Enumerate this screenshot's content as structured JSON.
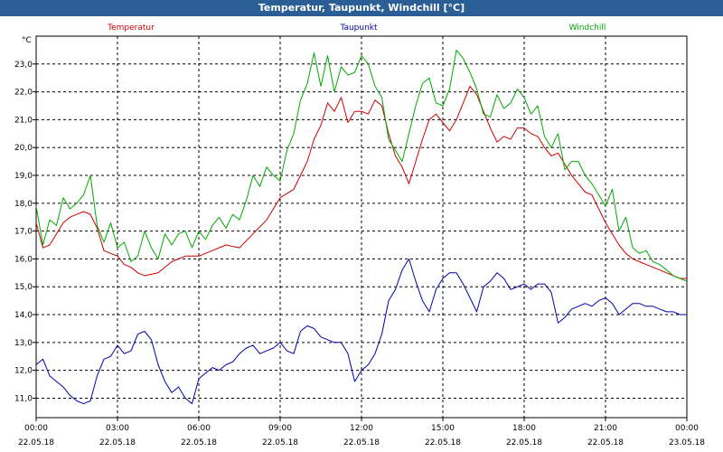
{
  "window": {
    "title": "Temperatur, Taupunkt, Windchill [°C]"
  },
  "chart_data": {
    "type": "line",
    "title": "Temperatur, Taupunkt, Windchill [°C]",
    "ylabel": "°C",
    "ylim": [
      10.3,
      24.0
    ],
    "xlim": [
      0,
      24
    ],
    "yticks": [
      11.0,
      12.0,
      13.0,
      14.0,
      15.0,
      16.0,
      17.0,
      18.0,
      19.0,
      20.0,
      21.0,
      22.0,
      23.0
    ],
    "ytick_labels": [
      "11,0",
      "12,0",
      "13,0",
      "14,0",
      "15,0",
      "16,0",
      "17,0",
      "18,0",
      "19,0",
      "20,0",
      "21,0",
      "22,0",
      "23,0"
    ],
    "xticks": [
      {
        "pos": 0,
        "time": "00:00",
        "date": "22.05.18"
      },
      {
        "pos": 3,
        "time": "03:00",
        "date": "22.05.18"
      },
      {
        "pos": 6,
        "time": "06:00",
        "date": "22.05.18"
      },
      {
        "pos": 9,
        "time": "09:00",
        "date": "22.05.18"
      },
      {
        "pos": 12,
        "time": "12:00",
        "date": "22.05.18"
      },
      {
        "pos": 15,
        "time": "15:00",
        "date": "22.05.18"
      },
      {
        "pos": 18,
        "time": "18:00",
        "date": "22.05.18"
      },
      {
        "pos": 21,
        "time": "21:00",
        "date": "22.05.18"
      },
      {
        "pos": 24,
        "time": "00:00",
        "date": "23.05.18"
      }
    ],
    "grid": true,
    "series": [
      {
        "name": "Temperatur",
        "color": "#cc0000",
        "x": [
          0,
          0.25,
          0.5,
          0.75,
          1,
          1.25,
          1.5,
          1.75,
          2,
          2.25,
          2.5,
          2.75,
          3,
          3.25,
          3.5,
          3.75,
          4,
          4.5,
          5,
          5.5,
          6,
          6.5,
          7,
          7.5,
          8,
          8.5,
          9,
          9.5,
          10,
          10.25,
          10.5,
          10.75,
          11,
          11.25,
          11.5,
          11.75,
          12,
          12.25,
          12.5,
          12.75,
          13,
          13.25,
          13.5,
          13.75,
          14,
          14.25,
          14.5,
          14.75,
          15,
          15.25,
          15.5,
          15.75,
          16,
          16.25,
          16.5,
          16.75,
          17,
          17.25,
          17.5,
          17.75,
          18,
          18.25,
          18.5,
          18.75,
          19,
          19.25,
          19.5,
          19.75,
          20,
          20.25,
          20.5,
          20.75,
          21,
          21.25,
          21.5,
          21.75,
          22,
          22.25,
          22.5,
          22.75,
          23,
          23.25,
          23.5,
          23.75,
          24
        ],
        "values": [
          17.3,
          16.4,
          16.5,
          16.9,
          17.3,
          17.5,
          17.6,
          17.7,
          17.6,
          17.1,
          16.3,
          16.2,
          16.1,
          15.8,
          15.7,
          15.5,
          15.4,
          15.5,
          15.9,
          16.1,
          16.1,
          16.3,
          16.5,
          16.4,
          16.9,
          17.4,
          18.2,
          18.5,
          19.5,
          20.3,
          20.8,
          21.6,
          21.3,
          21.8,
          20.9,
          21.3,
          21.3,
          21.2,
          21.7,
          21.5,
          20.5,
          19.7,
          19.3,
          18.7,
          19.5,
          20.3,
          21.0,
          21.2,
          20.9,
          20.6,
          21.0,
          21.6,
          22.2,
          21.9,
          21.3,
          20.7,
          20.2,
          20.4,
          20.3,
          20.7,
          20.7,
          20.5,
          20.4,
          20.0,
          19.7,
          19.8,
          19.4,
          19.0,
          18.7,
          18.4,
          18.3,
          17.8,
          17.3,
          16.9,
          16.5,
          16.2,
          16.0,
          15.9,
          15.8,
          15.7,
          15.6,
          15.5,
          15.4,
          15.3,
          15.3
        ]
      },
      {
        "name": "Taupunkt",
        "color": "#0000aa",
        "x": [
          0,
          0.25,
          0.5,
          0.75,
          1,
          1.25,
          1.5,
          1.75,
          2,
          2.25,
          2.5,
          2.75,
          3,
          3.25,
          3.5,
          3.75,
          4,
          4.25,
          4.5,
          4.75,
          5,
          5.25,
          5.5,
          5.75,
          6,
          6.25,
          6.5,
          6.75,
          7,
          7.25,
          7.5,
          7.75,
          8,
          8.25,
          8.5,
          8.75,
          9,
          9.25,
          9.5,
          9.75,
          10,
          10.25,
          10.5,
          10.75,
          11,
          11.25,
          11.5,
          11.75,
          12,
          12.25,
          12.5,
          12.75,
          13,
          13.25,
          13.5,
          13.75,
          14,
          14.25,
          14.5,
          14.75,
          15,
          15.25,
          15.5,
          15.75,
          16,
          16.25,
          16.5,
          16.75,
          17,
          17.25,
          17.5,
          17.75,
          18,
          18.25,
          18.5,
          18.75,
          19,
          19.25,
          19.5,
          19.75,
          20,
          20.25,
          20.5,
          20.75,
          21,
          21.25,
          21.5,
          21.75,
          22,
          22.25,
          22.5,
          22.75,
          23,
          23.25,
          23.5,
          23.75,
          24
        ],
        "values": [
          12.2,
          12.4,
          11.8,
          11.6,
          11.4,
          11.1,
          10.9,
          10.8,
          10.9,
          11.8,
          12.4,
          12.5,
          12.9,
          12.6,
          12.7,
          13.3,
          13.4,
          13.1,
          12.2,
          11.6,
          11.2,
          11.4,
          11.0,
          10.8,
          11.7,
          11.9,
          12.1,
          12.0,
          12.2,
          12.3,
          12.6,
          12.8,
          12.9,
          12.6,
          12.7,
          12.8,
          13.0,
          12.7,
          12.6,
          13.4,
          13.6,
          13.5,
          13.2,
          13.1,
          13.0,
          13.0,
          12.6,
          11.6,
          12.0,
          12.2,
          12.6,
          13.3,
          14.5,
          14.9,
          15.6,
          16.0,
          15.2,
          14.5,
          14.1,
          14.9,
          15.3,
          15.5,
          15.5,
          15.1,
          14.6,
          14.1,
          15.0,
          15.2,
          15.5,
          15.3,
          14.9,
          15.0,
          15.1,
          14.9,
          15.1,
          15.1,
          14.8,
          13.7,
          13.9,
          14.2,
          14.3,
          14.4,
          14.3,
          14.5,
          14.6,
          14.4,
          14.0,
          14.2,
          14.4,
          14.4,
          14.3,
          14.3,
          14.2,
          14.1,
          14.1,
          14.0,
          14.0
        ]
      },
      {
        "name": "Windchill",
        "color": "#00aa00",
        "x": [
          0,
          0.25,
          0.5,
          0.75,
          1,
          1.25,
          1.5,
          1.75,
          2,
          2.25,
          2.5,
          2.75,
          3,
          3.25,
          3.5,
          3.75,
          4,
          4.25,
          4.5,
          4.75,
          5,
          5.25,
          5.5,
          5.75,
          6,
          6.25,
          6.5,
          6.75,
          7,
          7.25,
          7.5,
          7.75,
          8,
          8.25,
          8.5,
          8.75,
          9,
          9.25,
          9.5,
          9.75,
          10,
          10.25,
          10.5,
          10.75,
          11,
          11.25,
          11.5,
          11.75,
          12,
          12.25,
          12.5,
          12.75,
          13,
          13.25,
          13.5,
          13.75,
          14,
          14.25,
          14.5,
          14.75,
          15,
          15.25,
          15.5,
          15.75,
          16,
          16.25,
          16.5,
          16.75,
          17,
          17.25,
          17.5,
          17.75,
          18,
          18.25,
          18.5,
          18.75,
          19,
          19.25,
          19.5,
          19.75,
          20,
          20.25,
          20.5,
          20.75,
          21,
          21.25,
          21.5,
          21.75,
          22,
          22.25,
          22.5,
          22.75,
          23,
          23.25,
          23.5,
          23.75,
          24
        ],
        "values": [
          17.9,
          16.5,
          17.4,
          17.2,
          18.2,
          17.8,
          18.0,
          18.3,
          19.0,
          17.2,
          16.6,
          17.3,
          16.4,
          16.6,
          15.9,
          16.1,
          17.0,
          16.4,
          16.0,
          16.9,
          16.5,
          16.9,
          17.0,
          16.4,
          17.0,
          16.7,
          17.2,
          17.5,
          17.1,
          17.6,
          17.4,
          18.1,
          19.0,
          18.6,
          19.3,
          19.0,
          18.8,
          19.9,
          20.5,
          21.7,
          22.3,
          23.4,
          22.2,
          23.3,
          22.0,
          22.9,
          22.6,
          22.7,
          23.3,
          23.0,
          22.2,
          21.8,
          20.3,
          19.9,
          19.5,
          20.5,
          21.5,
          22.3,
          22.5,
          21.6,
          21.5,
          22.1,
          23.5,
          23.2,
          22.7,
          22.1,
          21.2,
          21.1,
          21.9,
          21.4,
          21.6,
          22.1,
          21.8,
          21.2,
          21.5,
          20.4,
          20.0,
          20.5,
          19.2,
          19.5,
          19.5,
          19.0,
          18.7,
          18.3,
          17.9,
          18.5,
          17.0,
          17.5,
          16.4,
          16.2,
          16.3,
          15.9,
          15.8,
          15.6,
          15.4,
          15.3,
          15.2
        ]
      }
    ]
  }
}
